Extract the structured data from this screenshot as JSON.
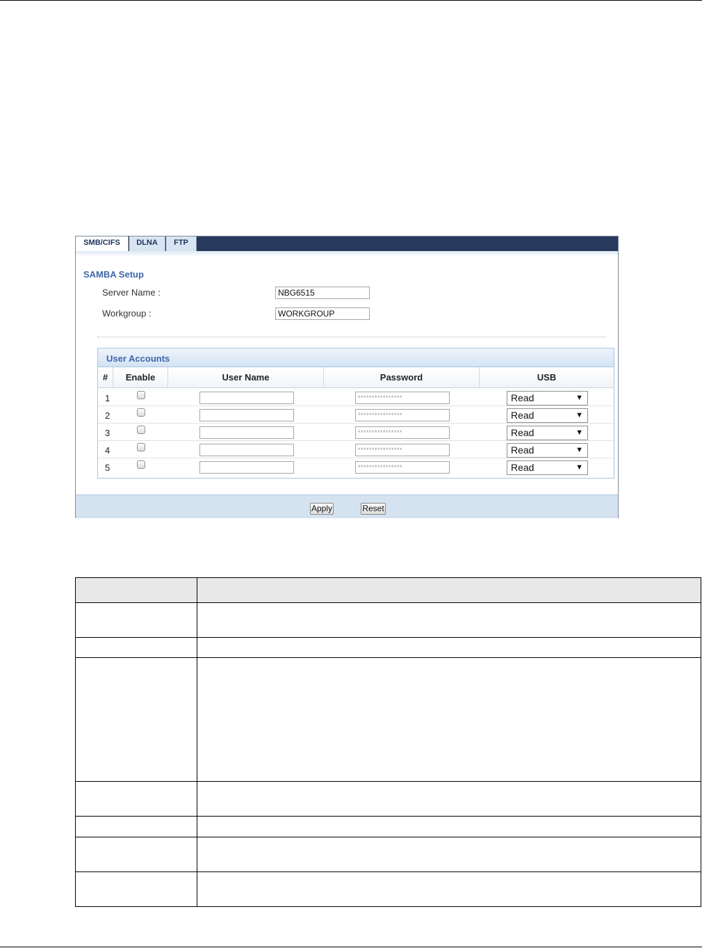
{
  "tabs": [
    {
      "label": "SMB/CIFS",
      "active": true
    },
    {
      "label": "DLNA",
      "active": false
    },
    {
      "label": "FTP",
      "active": false
    }
  ],
  "samba": {
    "section_title": "SAMBA Setup",
    "server_name_label": "Server Name :",
    "server_name_value": "NBG6515",
    "workgroup_label": "Workgroup :",
    "workgroup_value": "WORKGROUP"
  },
  "user_accounts": {
    "title": "User Accounts",
    "columns": [
      "#",
      "Enable",
      "User Name",
      "Password",
      "USB"
    ],
    "rows": [
      {
        "num": "1",
        "enabled": false,
        "user_name": "",
        "password": "****************",
        "usb": "Read"
      },
      {
        "num": "2",
        "enabled": false,
        "user_name": "",
        "password": "****************",
        "usb": "Read"
      },
      {
        "num": "3",
        "enabled": false,
        "user_name": "",
        "password": "****************",
        "usb": "Read"
      },
      {
        "num": "4",
        "enabled": false,
        "user_name": "",
        "password": "****************",
        "usb": "Read"
      },
      {
        "num": "5",
        "enabled": false,
        "user_name": "",
        "password": "****************",
        "usb": "Read"
      }
    ]
  },
  "buttons": {
    "apply": "Apply",
    "reset": "Reset"
  },
  "icons": {
    "dropdown_arrow": "▼"
  }
}
